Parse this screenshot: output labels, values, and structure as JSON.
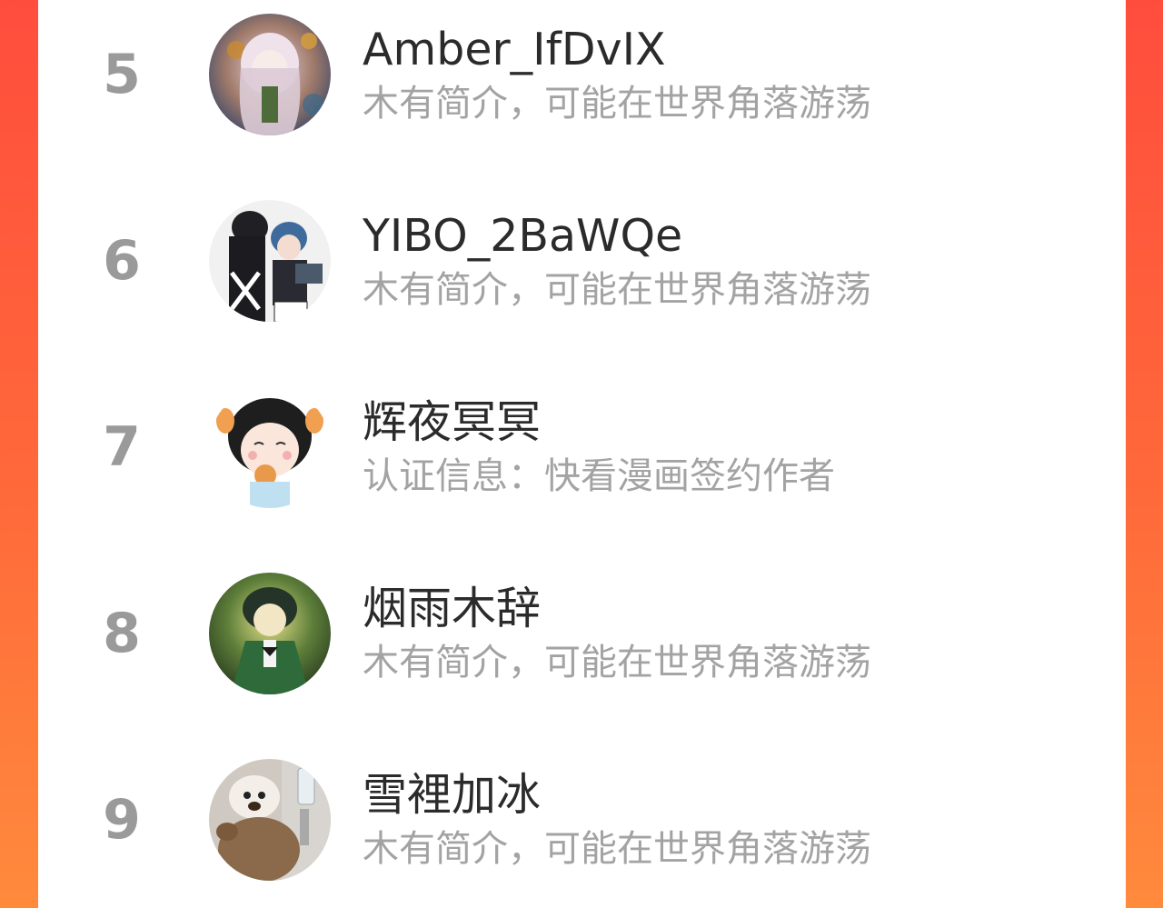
{
  "colors": {
    "background_gradient": [
      "#ff4d3d",
      "#ff8a3c"
    ],
    "panel": "#ffffff",
    "rank_text": "#9a9a9a",
    "name_text": "#2b2b2b",
    "desc_text": "#a3a3a3"
  },
  "ranking": {
    "items": [
      {
        "rank": "5",
        "name": "Amber_IfDvIX",
        "desc": "木有简介，可能在世界角落游荡",
        "avatar_icon": "avatar-anime-girl-icon"
      },
      {
        "rank": "6",
        "name": "YIBO_2BaWQe",
        "desc": "木有简介，可能在世界角落游荡",
        "avatar_icon": "avatar-anime-duo-icon"
      },
      {
        "rank": "7",
        "name": "辉夜冥冥",
        "desc": "认证信息：快看漫画签约作者",
        "avatar_icon": "avatar-chibi-girl-icon"
      },
      {
        "rank": "8",
        "name": "烟雨木辞",
        "desc": "木有简介，可能在世界角落游荡",
        "avatar_icon": "avatar-green-character-icon"
      },
      {
        "rank": "9",
        "name": "雪裡加冰",
        "desc": "木有简介，可能在世界角落游荡",
        "avatar_icon": "avatar-teddy-bear-icon"
      }
    ]
  }
}
